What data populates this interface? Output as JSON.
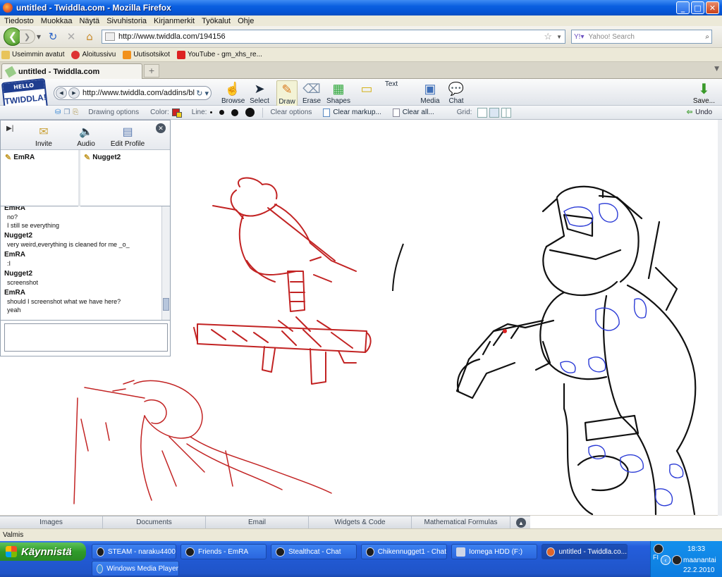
{
  "window": {
    "title": "untitled - Twiddla.com - Mozilla Firefox"
  },
  "menubar": [
    "Tiedosto",
    "Muokkaa",
    "Näytä",
    "Sivuhistoria",
    "Kirjanmerkit",
    "Työkalut",
    "Ohje"
  ],
  "navbar": {
    "url": "http://www.twiddla.com/194156",
    "search_placeholder": "Yahoo! Search"
  },
  "bookmarks": [
    "Useimmin avatut",
    "Aloitussivu",
    "Uutisotsikot",
    "YouTube - gm_xhs_re..."
  ],
  "tab": {
    "label": "untitled - Twiddla.com"
  },
  "logo": {
    "top": "HELLO",
    "bottom": "TWIDDLA!"
  },
  "twiddla_toolbar": {
    "url": "http://www.twiddla.com/addins/bl",
    "tools": [
      {
        "label": "Browse",
        "icon": "hand-icon"
      },
      {
        "label": "Select",
        "icon": "arrow-cursor-icon"
      },
      {
        "label": "Draw",
        "icon": "pencil-icon"
      },
      {
        "label": "Erase",
        "icon": "eraser-icon"
      },
      {
        "label": "Shapes",
        "icon": "shapes-icon"
      },
      {
        "label": "Text",
        "icon": "text-icon"
      },
      {
        "label": "Media",
        "icon": "media-icon"
      },
      {
        "label": "Chat",
        "icon": "chat-icon"
      }
    ],
    "save": "Save..."
  },
  "options_bar": {
    "drawing_options": "Drawing options",
    "color_label": "Color:",
    "line_label": "Line:",
    "clear_options": "Clear options",
    "clear_markup": "Clear markup...",
    "clear_all": "Clear all...",
    "grid_label": "Grid:",
    "undo": "Undo",
    "color": "#cc2222"
  },
  "sidebar": {
    "buttons": [
      "Invite",
      "Audio",
      "Edit Profile"
    ],
    "users": [
      {
        "name": "EmRA",
        "status_color": "#d93a3a"
      },
      {
        "name": "Nugget2",
        "status_color": "#222222"
      }
    ],
    "chat": [
      {
        "name": "EmRA",
        "lines": [
          "no?",
          "I still se everything"
        ]
      },
      {
        "name": "Nugget2",
        "lines": [
          "very weird,everything is cleaned for me _o_"
        ]
      },
      {
        "name": "EmRA",
        "lines": [
          ":I"
        ]
      },
      {
        "name": "Nugget2",
        "lines": [
          "screenshot"
        ]
      },
      {
        "name": "EmRA",
        "lines": [
          "should I screenshot what we have here?",
          "yeah"
        ]
      }
    ]
  },
  "widget_tabs": [
    "Images",
    "Documents",
    "Email",
    "Widgets & Code",
    "Mathematical Formulas"
  ],
  "statusbar": "Valmis",
  "taskbar": {
    "start": "Käynnistä",
    "buttons": [
      "STEAM - naraku4400",
      "Friends - EmRA",
      "Stealthcat - Chat",
      "Chikennugget1 - Chat",
      "Iomega HDD (F:)",
      "untitled - Twiddla.co...",
      "Windows Media Player"
    ],
    "lang": "FI",
    "time": "18:33",
    "day": "maanantai",
    "date": "22.2.2010"
  }
}
